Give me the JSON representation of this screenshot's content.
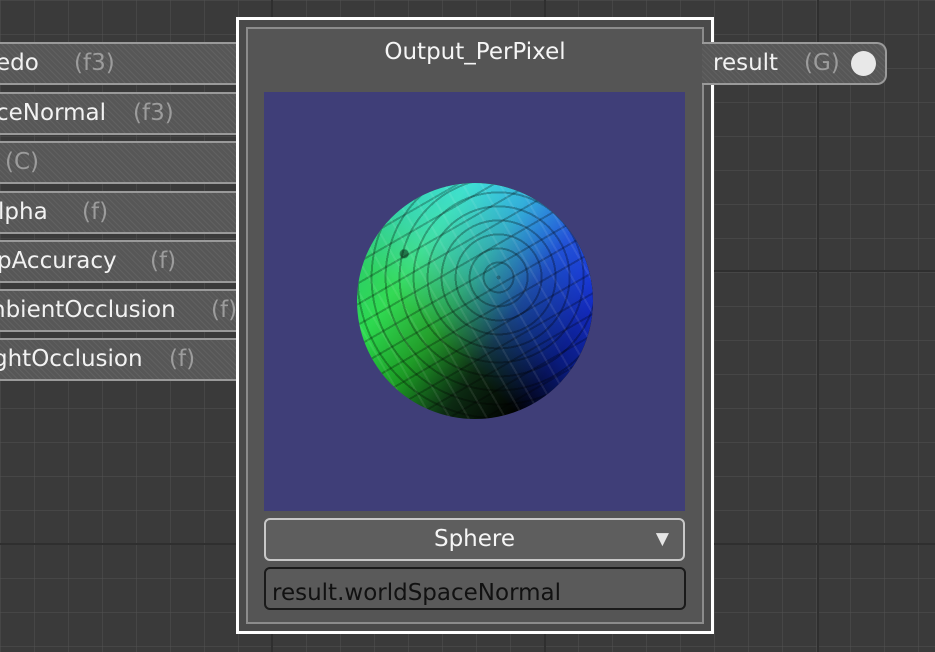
{
  "node": {
    "title": "Output_PerPixel",
    "shape_selected": "Sphere",
    "dropdown_arrow": "▼",
    "expression": "result.worldSpaceNormal"
  },
  "inputs": [
    {
      "label": "edo",
      "type": "(f3)"
    },
    {
      "label": "ceNormal",
      "type": "(f3)"
    },
    {
      "label": "",
      "type": "(C)"
    },
    {
      "label": "lpha",
      "type": "(f)"
    },
    {
      "label": "pAccuracy",
      "type": "(f)"
    },
    {
      "label": "nbientOcclusion",
      "type": "(f)"
    },
    {
      "label": "ghtOcclusion",
      "type": "(f)"
    }
  ],
  "output": {
    "label": "result",
    "type": "(G)"
  },
  "icons": {
    "output_connector": "output-pin-dot-icon",
    "dropdown": "chevron-down-icon"
  },
  "colors": {
    "background": "#3a3a3a",
    "preview_background": "#3f3e78",
    "node_border": "#ffffff",
    "type_text": "#9c9c9c"
  }
}
